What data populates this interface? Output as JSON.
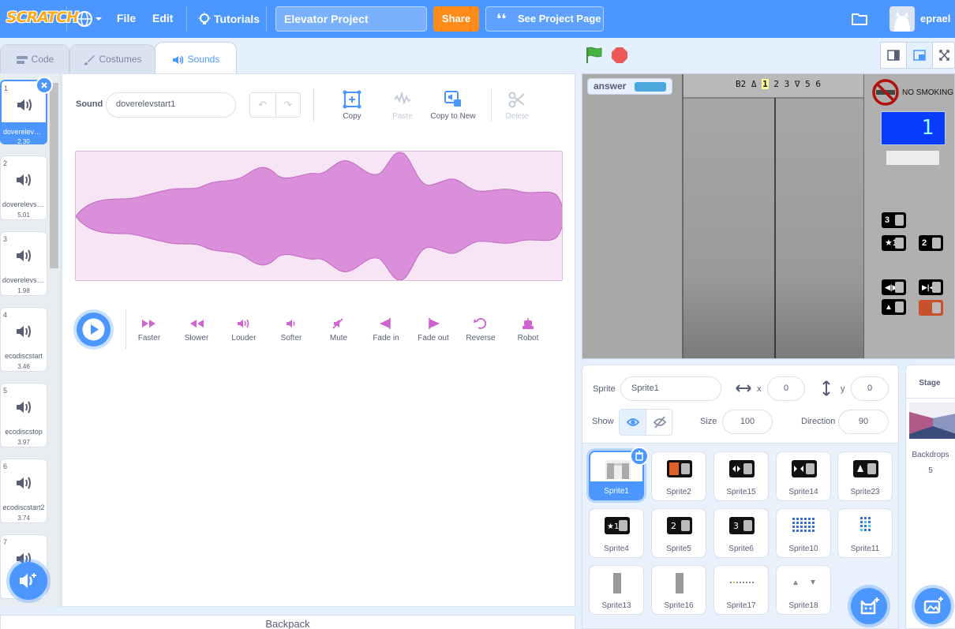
{
  "menu": {
    "logo": "SCRATCH",
    "file": "File",
    "edit": "Edit",
    "tutorials": "Tutorials",
    "project_title": "Elevator Project",
    "share": "Share",
    "see_project": "See Project Page",
    "username": "eprael"
  },
  "tabs": {
    "code": "Code",
    "costumes": "Costumes",
    "sounds": "Sounds"
  },
  "sounds": [
    {
      "num": "1",
      "name": "doverelevstart1",
      "duration": "2.30"
    },
    {
      "num": "2",
      "name": "doverelevstart2",
      "duration": "5.01"
    },
    {
      "num": "3",
      "name": "doverelevstop",
      "duration": "1.98"
    },
    {
      "num": "4",
      "name": "ecodiscstart",
      "duration": "3.46"
    },
    {
      "num": "5",
      "name": "ecodiscstop",
      "duration": "3.97"
    },
    {
      "num": "6",
      "name": "ecodiscstart2",
      "duration": "3.74"
    },
    {
      "num": "7",
      "name": "",
      "duration": ""
    }
  ],
  "editor": {
    "sound_label": "Sound",
    "sound_name": "doverelevstart1",
    "tools": {
      "copy": "Copy",
      "paste": "Paste",
      "copy_to_new": "Copy to New",
      "delete": "Delete"
    },
    "effects": {
      "faster": "Faster",
      "slower": "Slower",
      "louder": "Louder",
      "softer": "Softer",
      "mute": "Mute",
      "fade_in": "Fade in",
      "fade_out": "Fade out",
      "reverse": "Reverse",
      "robot": "Robot"
    }
  },
  "backpack": "Backpack",
  "stage": {
    "answer_label": "answer",
    "floor_indicator": [
      "B2",
      "Δ",
      "1",
      "2",
      "3",
      "∇",
      "5",
      "6"
    ],
    "no_smoking": "NO SMOKING",
    "floor_display": "1",
    "buttons": [
      "3",
      "★1",
      "2"
    ]
  },
  "sprite_info": {
    "sprite_label": "Sprite",
    "sprite_name": "Sprite1",
    "x_label": "x",
    "x": "0",
    "y_label": "y",
    "y": "0",
    "show_label": "Show",
    "size_label": "Size",
    "size": "100",
    "direction_label": "Direction",
    "direction": "90"
  },
  "sprites": [
    "Sprite1",
    "Sprite2",
    "Sprite15",
    "Sprite14",
    "Sprite23",
    "Sprite4",
    "Sprite5",
    "Sprite6",
    "Sprite10",
    "Sprite11",
    "Sprite13",
    "Sprite16",
    "Sprite17",
    "Sprite18"
  ],
  "stage_panel": {
    "title": "Stage",
    "backdrops_label": "Backdrops",
    "backdrops_count": "5"
  },
  "colors": {
    "primary": "#4c97ff",
    "share": "#ff8c1a",
    "sound_wave": "#d98fd9",
    "logo": "#ffab19"
  }
}
